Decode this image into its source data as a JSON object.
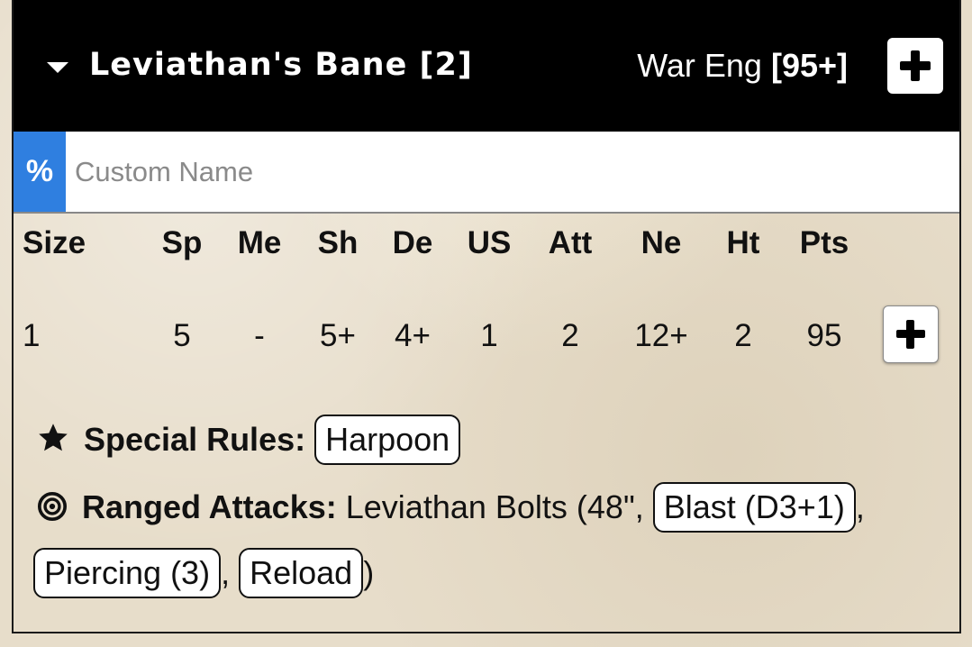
{
  "header": {
    "unit_name": "Leviathan's Bane [2]",
    "unit_type": "War Eng",
    "unit_points": "[95+]"
  },
  "custom_name": {
    "prefix_symbol": "%",
    "placeholder": "Custom Name",
    "value": ""
  },
  "stats": {
    "headers": [
      "Size",
      "Sp",
      "Me",
      "Sh",
      "De",
      "US",
      "Att",
      "Ne",
      "Ht",
      "Pts"
    ],
    "values": [
      "1",
      "5",
      "-",
      "5+",
      "4+",
      "1",
      "2",
      "12+",
      "2",
      "95"
    ]
  },
  "special_rules": {
    "label": "Special Rules:",
    "items": [
      "Harpoon"
    ]
  },
  "ranged_attacks": {
    "label": "Ranged Attacks:",
    "weapon_text": "Leviathan Bolts (48\",",
    "rules": [
      "Blast (D3+1)",
      "Piercing (3)",
      "Reload"
    ],
    "separator": ",",
    "close": ")"
  },
  "icons": {
    "collapse": "triangle-down-icon",
    "add": "plus-icon",
    "special_rules": "star-icon",
    "ranged": "target-icon"
  },
  "colors": {
    "header_bg": "#000000",
    "accent_blue": "#2f7fe0",
    "parchment": "#e7ddca"
  }
}
